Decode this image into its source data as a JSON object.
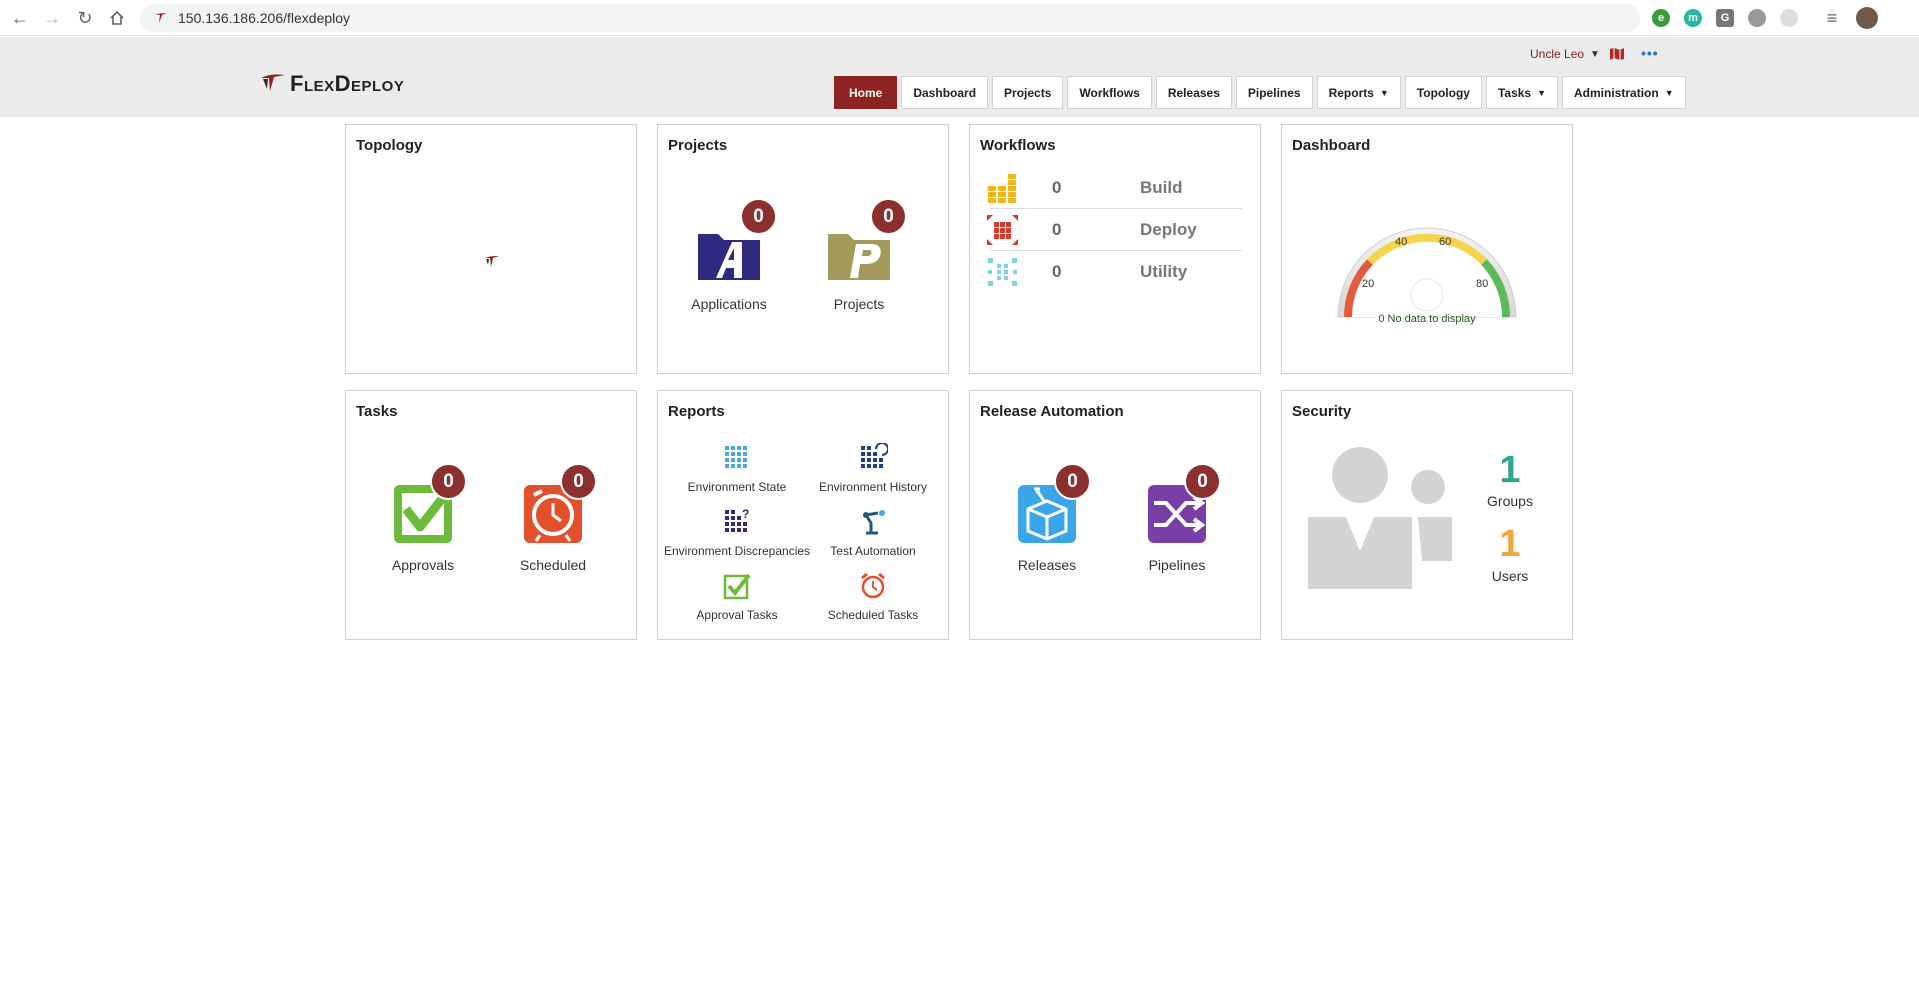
{
  "browser": {
    "url": "150.136.186.206/flexdeploy"
  },
  "header": {
    "logo_text": "FlexDeploy",
    "user_name": "Uncle Leo",
    "nav": [
      {
        "label": "Home",
        "active": true
      },
      {
        "label": "Dashboard"
      },
      {
        "label": "Projects"
      },
      {
        "label": "Workflows"
      },
      {
        "label": "Releases"
      },
      {
        "label": "Pipelines"
      },
      {
        "label": "Reports"
      },
      {
        "label": "Topology"
      },
      {
        "label": "Tasks"
      },
      {
        "label": "Administration"
      }
    ]
  },
  "cards": {
    "topology": {
      "title": "Topology"
    },
    "projects": {
      "title": "Projects",
      "applications": {
        "label": "Applications",
        "count": "0"
      },
      "projects": {
        "label": "Projects",
        "count": "0"
      }
    },
    "workflows": {
      "title": "Workflows",
      "rows": [
        {
          "count": "0",
          "label": "Build",
          "color": "#f2b51c"
        },
        {
          "count": "0",
          "label": "Deploy",
          "color": "#d63a2a"
        },
        {
          "count": "0",
          "label": "Utility",
          "color": "#7fd4e0"
        }
      ]
    },
    "dashboard": {
      "title": "Dashboard",
      "gauge": {
        "ticks": [
          "20",
          "40",
          "60",
          "80"
        ],
        "message": "0 No data to display"
      }
    },
    "tasks": {
      "title": "Tasks",
      "approvals": {
        "label": "Approvals",
        "count": "0"
      },
      "scheduled": {
        "label": "Scheduled",
        "count": "0"
      }
    },
    "reports": {
      "title": "Reports",
      "items": [
        {
          "label": "Environment State",
          "icon": "grid-icon"
        },
        {
          "label": "Environment History",
          "icon": "grid-history-icon"
        },
        {
          "label": "Environment Discrepancies",
          "icon": "grid-question-icon"
        },
        {
          "label": "Test Automation",
          "icon": "robot-arm-icon"
        },
        {
          "label": "Approval Tasks",
          "icon": "checkmark-icon"
        },
        {
          "label": "Scheduled Tasks",
          "icon": "alarm-clock-icon"
        }
      ]
    },
    "release_automation": {
      "title": "Release Automation",
      "releases": {
        "label": "Releases",
        "count": "0"
      },
      "pipelines": {
        "label": "Pipelines",
        "count": "0"
      }
    },
    "security": {
      "title": "Security",
      "groups": {
        "label": "Groups",
        "count": "1",
        "color": "#2fa98c"
      },
      "users": {
        "label": "Users",
        "count": "1",
        "color": "#f0a441"
      }
    }
  }
}
